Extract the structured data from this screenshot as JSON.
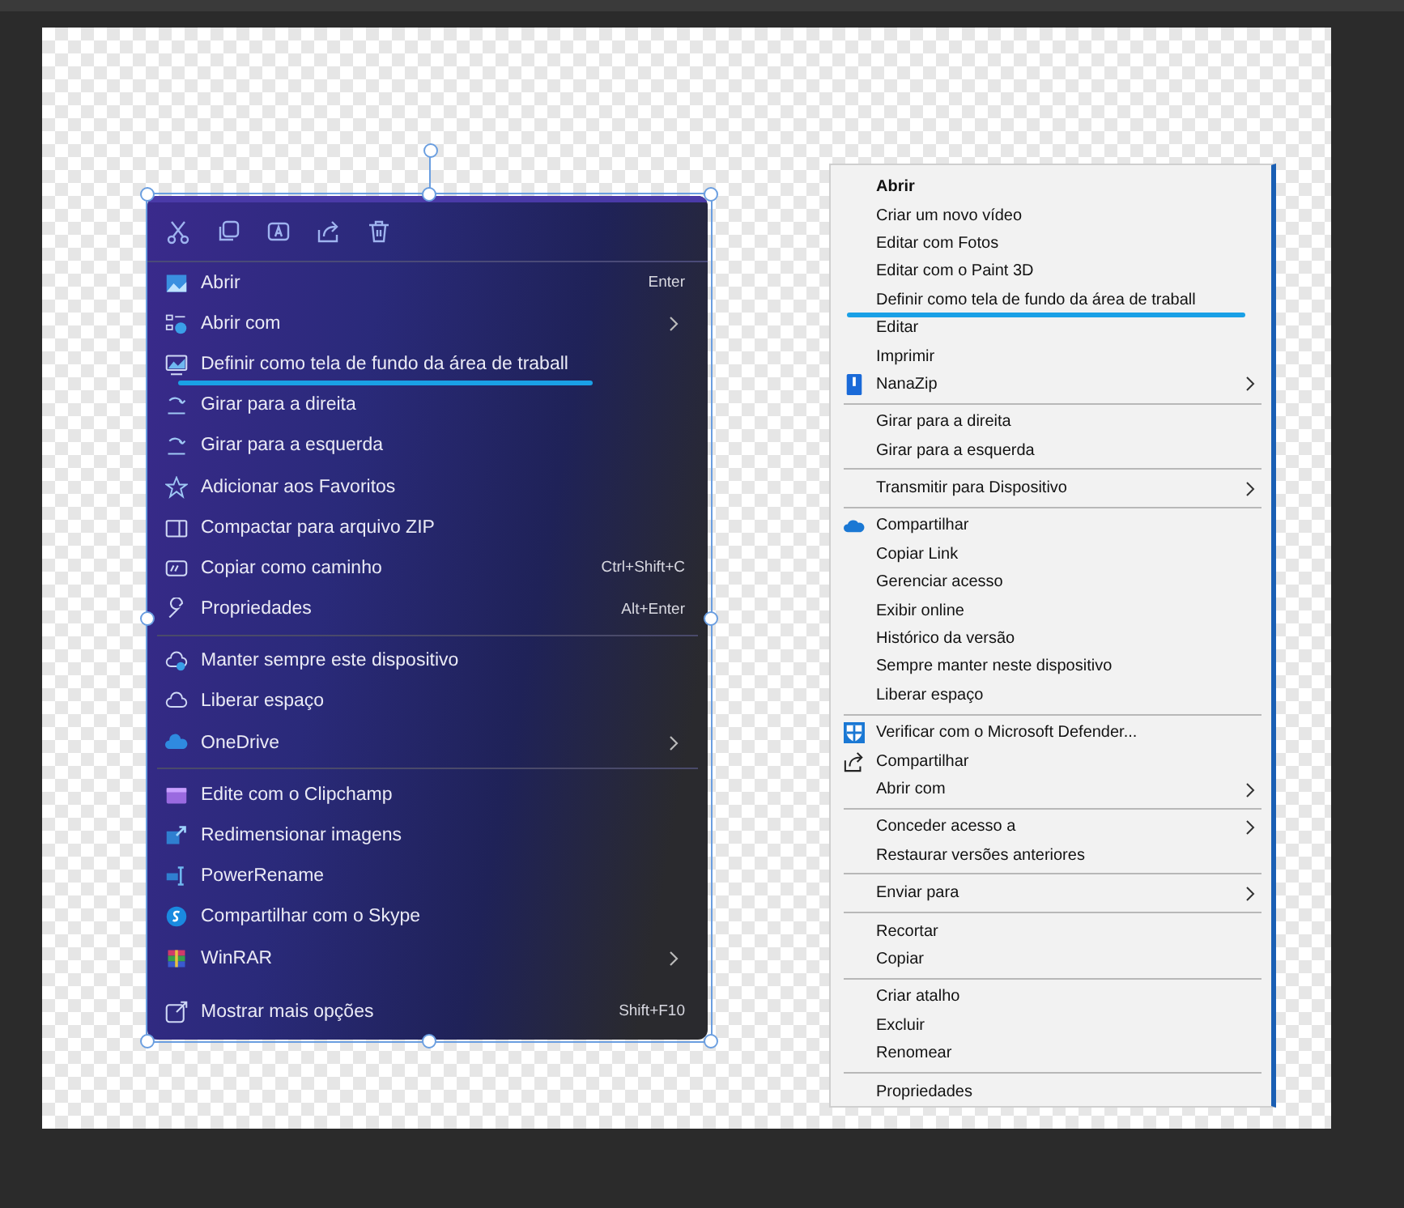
{
  "left_menu": {
    "groups": [
      {
        "divider": false,
        "items": [
          {
            "label": "Abrir",
            "shortcut": "Enter",
            "submenu": false,
            "underlined": false
          },
          {
            "label": "Abrir com",
            "submenu": true,
            "underlined": false
          },
          {
            "label": "Definir como tela de fundo da área de traball",
            "submenu": false,
            "underlined": true
          },
          {
            "label": "Girar para a direita",
            "submenu": false,
            "underlined": false
          },
          {
            "label": "Girar para a esquerda",
            "submenu": false,
            "underlined": false
          },
          {
            "label": "Adicionar aos Favoritos",
            "submenu": false,
            "underlined": false
          },
          {
            "label": "Compactar para arquivo ZIP",
            "submenu": false,
            "underlined": false
          },
          {
            "label": "Copiar como caminho",
            "shortcut": "Ctrl+Shift+C",
            "submenu": false,
            "underlined": false
          },
          {
            "label": "Propriedades",
            "shortcut": "Alt+Enter",
            "submenu": false,
            "underlined": false
          }
        ]
      },
      {
        "divider": true,
        "items": [
          {
            "label": "Manter sempre este dispositivo",
            "submenu": false,
            "underlined": false
          },
          {
            "label": "Liberar espaço",
            "submenu": false,
            "underlined": false
          },
          {
            "label": "OneDrive",
            "submenu": true,
            "underlined": false
          }
        ]
      },
      {
        "divider": true,
        "items": [
          {
            "label": "Edite com o Clipchamp",
            "submenu": false,
            "underlined": false
          },
          {
            "label": "Redimensionar imagens",
            "submenu": false,
            "underlined": false
          },
          {
            "label": "PowerRename",
            "submenu": false,
            "underlined": false
          },
          {
            "label": "Compartilhar com o Skype",
            "submenu": false,
            "underlined": false
          },
          {
            "label": "WinRAR",
            "submenu": true,
            "underlined": false
          }
        ]
      },
      {
        "divider": false,
        "items": [
          {
            "label": "Mostrar mais opções",
            "shortcut": "Shift+F10",
            "submenu": false,
            "underlined": false
          }
        ]
      }
    ]
  },
  "right_menu": {
    "groups": [
      {
        "items": [
          {
            "label": "Abrir",
            "default": true,
            "submenu": false,
            "underlined": false
          },
          {
            "label": "Criar um novo vídeo",
            "default": false,
            "submenu": false,
            "underlined": false
          },
          {
            "label": "Editar com Fotos",
            "default": false,
            "submenu": false,
            "underlined": false
          },
          {
            "label": "Editar com o Paint 3D",
            "default": false,
            "submenu": false,
            "underlined": false
          },
          {
            "label": "Definir como tela de fundo da área de traball",
            "default": false,
            "submenu": false,
            "underlined": true
          },
          {
            "label": "Editar",
            "default": false,
            "submenu": false,
            "underlined": false
          },
          {
            "label": "Imprimir",
            "default": false,
            "submenu": false,
            "underlined": false
          },
          {
            "label": "NanaZip",
            "default": false,
            "submenu": true,
            "underlined": false,
            "kind": "archive"
          }
        ]
      },
      {
        "items": [
          {
            "label": "Girar para a direita",
            "default": false,
            "submenu": false,
            "underlined": false
          },
          {
            "label": "Girar para a esquerda",
            "default": false,
            "submenu": false,
            "underlined": false
          }
        ]
      },
      {
        "items": [
          {
            "label": "Transmitir para Dispositivo",
            "default": false,
            "submenu": true,
            "underlined": false
          }
        ]
      },
      {
        "items": [
          {
            "label": "Compartilhar",
            "default": false,
            "submenu": false,
            "underlined": false,
            "kind": "cloud"
          },
          {
            "label": "Copiar Link",
            "default": false,
            "submenu": false,
            "underlined": false
          },
          {
            "label": "Gerenciar acesso",
            "default": false,
            "submenu": false,
            "underlined": false
          },
          {
            "label": "Exibir online",
            "default": false,
            "submenu": false,
            "underlined": false
          },
          {
            "label": "Histórico da versão",
            "default": false,
            "submenu": false,
            "underlined": false
          },
          {
            "label": "Sempre manter neste dispositivo",
            "default": false,
            "submenu": false,
            "underlined": false
          },
          {
            "label": "Liberar espaço",
            "default": false,
            "submenu": false,
            "underlined": false
          }
        ]
      },
      {
        "items": [
          {
            "label": "Verificar com o Microsoft Defender...",
            "default": false,
            "submenu": false,
            "underlined": false,
            "kind": "shield"
          },
          {
            "label": "Compartilhar",
            "default": false,
            "submenu": false,
            "underlined": false,
            "kind": "share"
          },
          {
            "label": "Abrir com",
            "default": false,
            "submenu": true,
            "underlined": false
          }
        ]
      },
      {
        "items": [
          {
            "label": "Conceder acesso a",
            "default": false,
            "submenu": true,
            "underlined": false
          },
          {
            "label": "Restaurar versões anteriores",
            "default": false,
            "submenu": false,
            "underlined": false
          }
        ]
      },
      {
        "items": [
          {
            "label": "Enviar para",
            "default": false,
            "submenu": true,
            "underlined": false
          }
        ]
      },
      {
        "items": [
          {
            "label": "Recortar",
            "default": false,
            "submenu": false,
            "underlined": false
          },
          {
            "label": "Copiar",
            "default": false,
            "submenu": false,
            "underlined": false
          }
        ]
      },
      {
        "items": [
          {
            "label": "Criar atalho",
            "default": false,
            "submenu": false,
            "underlined": false
          },
          {
            "label": "Excluir",
            "default": false,
            "submenu": false,
            "underlined": false
          },
          {
            "label": "Renomear",
            "default": false,
            "submenu": false,
            "underlined": false
          }
        ]
      },
      {
        "items": [
          {
            "label": "Propriedades",
            "default": false,
            "submenu": false,
            "underlined": false
          }
        ]
      }
    ]
  }
}
